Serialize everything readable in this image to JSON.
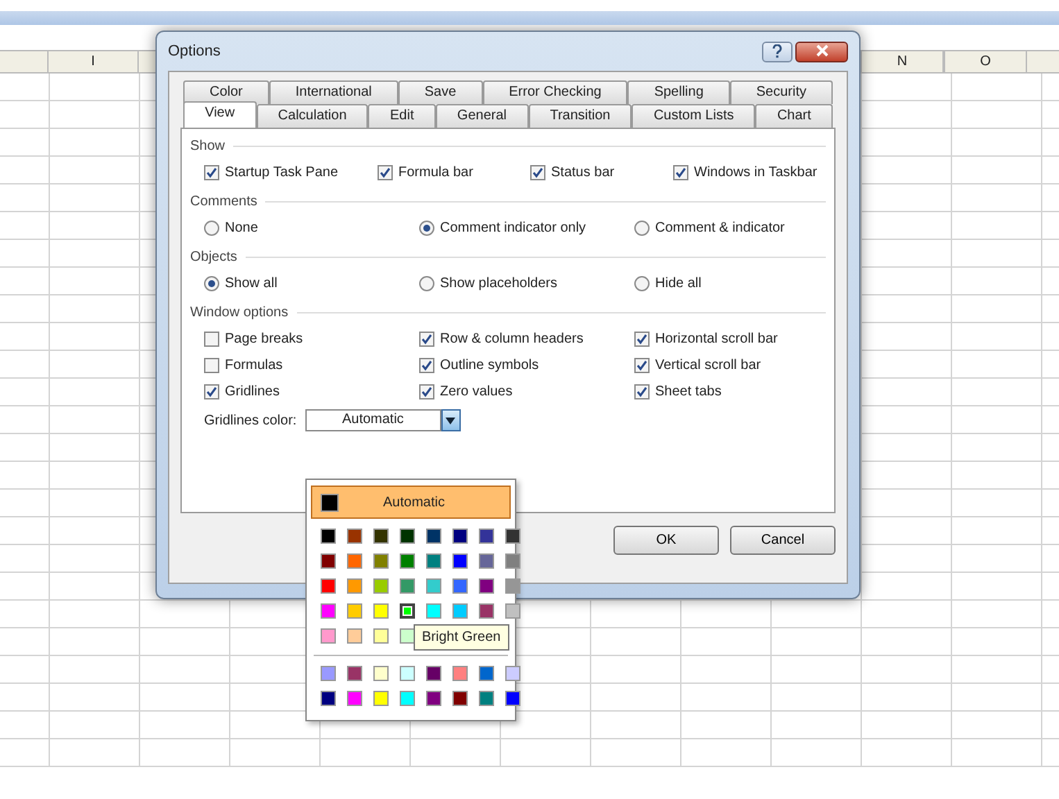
{
  "sheet": {
    "column_headers": [
      {
        "label": "I",
        "kind": "left"
      },
      {
        "label": "N",
        "kind": "right"
      },
      {
        "label": "O",
        "kind": "right"
      }
    ]
  },
  "dialog": {
    "title": "Options",
    "tab_rows": [
      [
        {
          "label": "Color",
          "selected": false
        },
        {
          "label": "International",
          "selected": false
        },
        {
          "label": "Save",
          "selected": false
        },
        {
          "label": "Error Checking",
          "selected": false
        },
        {
          "label": "Spelling",
          "selected": false
        },
        {
          "label": "Security",
          "selected": false
        }
      ],
      [
        {
          "label": "View",
          "selected": true
        },
        {
          "label": "Calculation",
          "selected": false
        },
        {
          "label": "Edit",
          "selected": false
        },
        {
          "label": "General",
          "selected": false
        },
        {
          "label": "Transition",
          "selected": false
        },
        {
          "label": "Custom Lists",
          "selected": false
        },
        {
          "label": "Chart",
          "selected": false
        }
      ]
    ],
    "sections": [
      {
        "title": "Show",
        "kind": "checks",
        "items": [
          {
            "label": "Startup Task Pane",
            "checked": true
          },
          {
            "label": "Formula bar",
            "checked": true
          },
          {
            "label": "Status bar",
            "checked": true
          },
          {
            "label": "Windows in Taskbar",
            "checked": true
          }
        ]
      },
      {
        "title": "Comments",
        "kind": "radios",
        "items": [
          {
            "label": "None",
            "selected": false
          },
          {
            "label": "Comment indicator only",
            "selected": true
          },
          {
            "label": "Comment & indicator",
            "selected": false
          }
        ]
      },
      {
        "title": "Objects",
        "kind": "radios",
        "items": [
          {
            "label": "Show all",
            "selected": true
          },
          {
            "label": "Show placeholders",
            "selected": false
          },
          {
            "label": "Hide all",
            "selected": false
          }
        ]
      },
      {
        "title": "Window options",
        "kind": "checks",
        "items": [
          {
            "label": "Page breaks",
            "checked": false
          },
          {
            "label": "Row & column headers",
            "checked": true
          },
          {
            "label": "Horizontal scroll bar",
            "checked": true
          },
          {
            "label": "Formulas",
            "checked": false
          },
          {
            "label": "Outline symbols",
            "checked": true
          },
          {
            "label": "Vertical scroll bar",
            "checked": true
          },
          {
            "label": "Gridlines",
            "checked": true
          },
          {
            "label": "Zero values",
            "checked": true
          },
          {
            "label": "Sheet tabs",
            "checked": true
          }
        ]
      }
    ],
    "gridlines_color": {
      "label": "Gridlines color:",
      "value": "Automatic"
    },
    "buttons": [
      "OK",
      "Cancel"
    ]
  },
  "color_popup": {
    "automatic": {
      "label": "Automatic",
      "color": "#000000"
    },
    "rows": [
      [
        {
          "color": "#000000",
          "selected": false
        },
        {
          "color": "#993300",
          "selected": false
        },
        {
          "color": "#333300",
          "selected": false
        },
        {
          "color": "#003300",
          "selected": false
        },
        {
          "color": "#003366",
          "selected": false
        },
        {
          "color": "#000080",
          "selected": false
        },
        {
          "color": "#333399",
          "selected": false
        },
        {
          "color": "#333333",
          "selected": false
        }
      ],
      [
        {
          "color": "#800000",
          "selected": false
        },
        {
          "color": "#ff6600",
          "selected": false
        },
        {
          "color": "#808000",
          "selected": false
        },
        {
          "color": "#008000",
          "selected": false
        },
        {
          "color": "#008080",
          "selected": false
        },
        {
          "color": "#0000ff",
          "selected": false
        },
        {
          "color": "#666699",
          "selected": false
        },
        {
          "color": "#808080",
          "selected": false
        }
      ],
      [
        {
          "color": "#ff0000",
          "selected": false
        },
        {
          "color": "#ff9900",
          "selected": false
        },
        {
          "color": "#99cc00",
          "selected": false
        },
        {
          "color": "#339966",
          "selected": false
        },
        {
          "color": "#33cccc",
          "selected": false
        },
        {
          "color": "#3366ff",
          "selected": false
        },
        {
          "color": "#800080",
          "selected": false
        },
        {
          "color": "#969696",
          "selected": false
        }
      ],
      [
        {
          "color": "#ff00ff",
          "selected": false
        },
        {
          "color": "#ffcc00",
          "selected": false
        },
        {
          "color": "#ffff00",
          "selected": false
        },
        {
          "color": "#00ff00",
          "selected": true
        },
        {
          "color": "#00ffff",
          "selected": false
        },
        {
          "color": "#00ccff",
          "selected": false
        },
        {
          "color": "#993366",
          "selected": false
        },
        {
          "color": "#c0c0c0",
          "selected": false
        }
      ],
      [
        {
          "color": "#ff99cc",
          "selected": false
        },
        {
          "color": "#ffcc99",
          "selected": false
        },
        {
          "color": "#ffff99",
          "selected": false
        },
        {
          "color": "#ccffcc",
          "selected": false
        }
      ]
    ],
    "tooltip": "Bright Green",
    "chart_rows": [
      [
        {
          "color": "#9999ff",
          "selected": false
        },
        {
          "color": "#993366",
          "selected": false
        },
        {
          "color": "#ffffcc",
          "selected": false
        },
        {
          "color": "#ccffff",
          "selected": false
        },
        {
          "color": "#660066",
          "selected": false
        },
        {
          "color": "#ff8080",
          "selected": false
        },
        {
          "color": "#0066cc",
          "selected": false
        },
        {
          "color": "#ccccff",
          "selected": false
        }
      ],
      [
        {
          "color": "#000080",
          "selected": false
        },
        {
          "color": "#ff00ff",
          "selected": false
        },
        {
          "color": "#ffff00",
          "selected": false
        },
        {
          "color": "#00ffff",
          "selected": false
        },
        {
          "color": "#800080",
          "selected": false
        },
        {
          "color": "#800000",
          "selected": false
        },
        {
          "color": "#008080",
          "selected": false
        },
        {
          "color": "#0000ff",
          "selected": false
        }
      ]
    ]
  }
}
